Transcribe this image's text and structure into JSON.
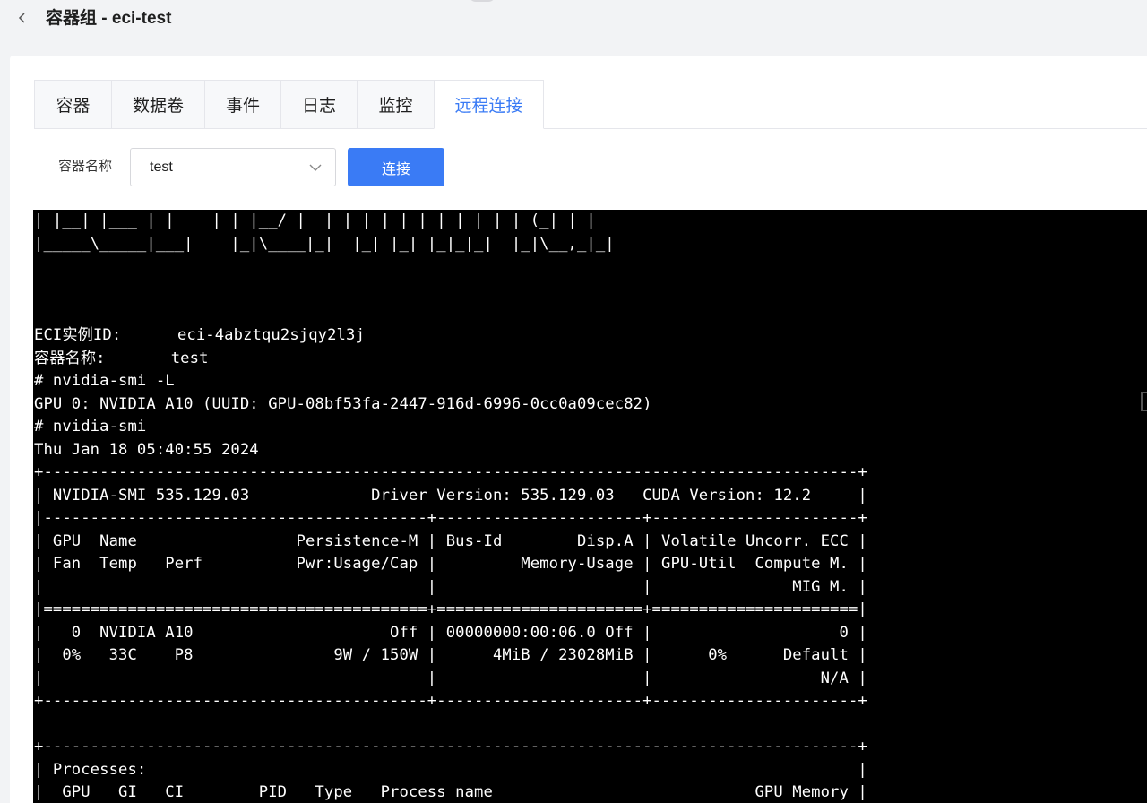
{
  "header": {
    "title": "容器组 - eci-test"
  },
  "tabs": [
    {
      "label": "容器",
      "active": false
    },
    {
      "label": "数据卷",
      "active": false
    },
    {
      "label": "事件",
      "active": false
    },
    {
      "label": "日志",
      "active": false
    },
    {
      "label": "监控",
      "active": false
    },
    {
      "label": "远程连接",
      "active": true
    }
  ],
  "form": {
    "container_label": "容器名称",
    "container_select_value": "test",
    "connect_label": "连接"
  },
  "terminal": {
    "banner": "| |__| |___ | |    | | |__/ |  | | | | | | | | | | | (_| | |\n|_____\\_____|___|    |_|\\____|_|  |_| |_| |_|_|_|  |_|\\__,_|_|",
    "body": "ECI实例ID:      eci-4abztqu2sjqy2l3j\n容器名称:       test\n# nvidia-smi -L\nGPU 0: NVIDIA A10 (UUID: GPU-08bf53fa-2447-916d-6996-0cc0a09cec82)\n# nvidia-smi\nThu Jan 18 05:40:55 2024\n+---------------------------------------------------------------------------------------+\n| NVIDIA-SMI 535.129.03             Driver Version: 535.129.03   CUDA Version: 12.2     |\n|-----------------------------------------+----------------------+----------------------+\n| GPU  Name                 Persistence-M | Bus-Id        Disp.A | Volatile Uncorr. ECC |\n| Fan  Temp   Perf          Pwr:Usage/Cap |         Memory-Usage | GPU-Util  Compute M. |\n|                                         |                      |               MIG M. |\n|=========================================+======================+======================|\n|   0  NVIDIA A10                     Off | 00000000:00:06.0 Off |                    0 |\n|  0%   33C    P8               9W / 150W |      4MiB / 23028MiB |      0%      Default |\n|                                         |                      |                  N/A |\n+-----------------------------------------+----------------------+----------------------+\n\n+---------------------------------------------------------------------------------------+\n| Processes:                                                                            |\n|  GPU   GI   CI        PID   Type   Process name                            GPU Memory |"
  }
}
